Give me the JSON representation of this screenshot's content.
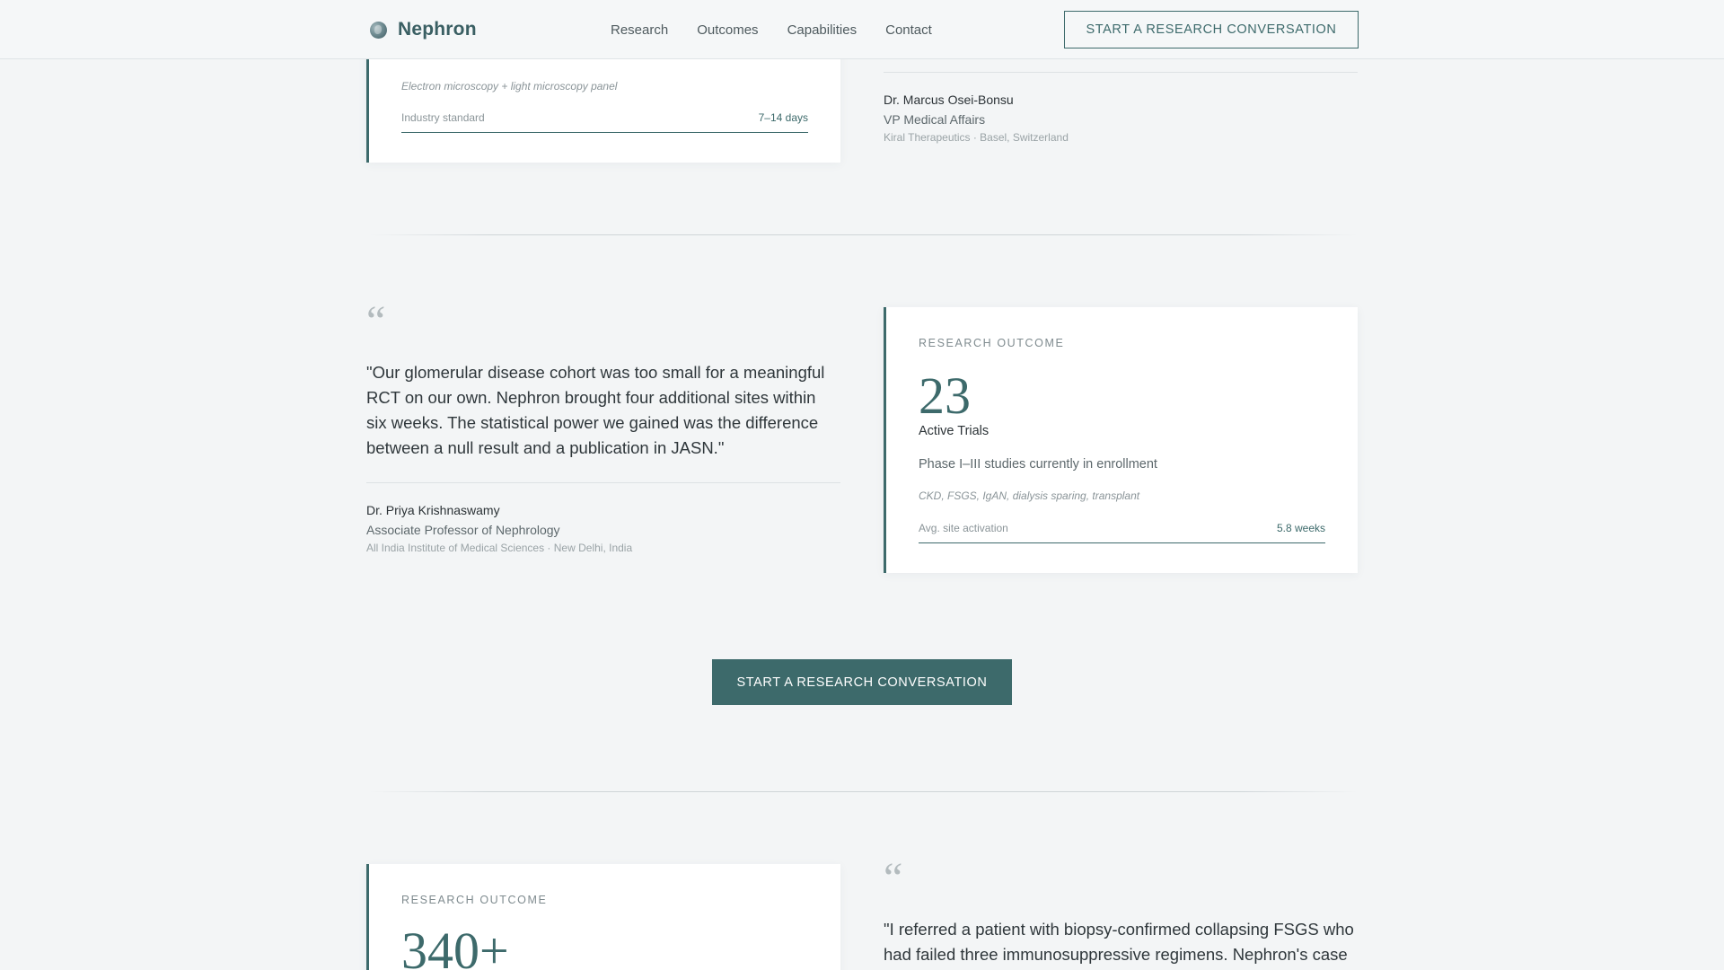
{
  "header": {
    "brand": "Nephron",
    "nav": [
      "Research",
      "Outcomes",
      "Capabilities",
      "Contact"
    ],
    "cta": "START A RESEARCH CONVERSATION"
  },
  "top_card": {
    "tags": "Electron microscopy + light microscopy panel",
    "metric_label": "Industry standard",
    "metric_value": "7–14 days"
  },
  "top_testimonial": {
    "author": "Dr. Marcus Osei-Bonsu",
    "role": "VP Medical Affairs",
    "org": "Kiral Therapeutics · Basel, Switzerland"
  },
  "middle_testimonial": {
    "quote": "\"Our glomerular disease cohort was too small for a meaningful RCT on our own. Nephron brought four additional sites within six weeks. The statistical power we gained was the difference between a null result and a publication in JASN.\"",
    "author": "Dr. Priya Krishnaswamy",
    "role": "Associate Professor of Nephrology",
    "org": "All India Institute of Medical Sciences · New Delhi, India"
  },
  "middle_card": {
    "eyebrow": "RESEARCH OUTCOME",
    "number": "23",
    "number_label": "Active Trials",
    "description": "Phase I–III studies currently in enrollment",
    "tags": "CKD, FSGS, IgAN, dialysis sparing, transplant",
    "metric_label": "Avg. site activation",
    "metric_value": "5.8 weeks"
  },
  "main_cta": "START A RESEARCH CONVERSATION",
  "bottom_card": {
    "eyebrow": "RESEARCH OUTCOME",
    "number": "340+"
  },
  "bottom_testimonial": {
    "quote": "\"I referred a patient with biopsy-confirmed collapsing FSGS who had failed three immunosuppressive regimens. Nephron's case"
  },
  "quote_glyph": "“",
  "colors": {
    "accent": "#3d6a6b",
    "background": "#f3f5f6",
    "card": "#ffffff",
    "muted_text": "#8a9498"
  },
  "icons": {
    "brand_logo": "kidney-globe-icon"
  }
}
